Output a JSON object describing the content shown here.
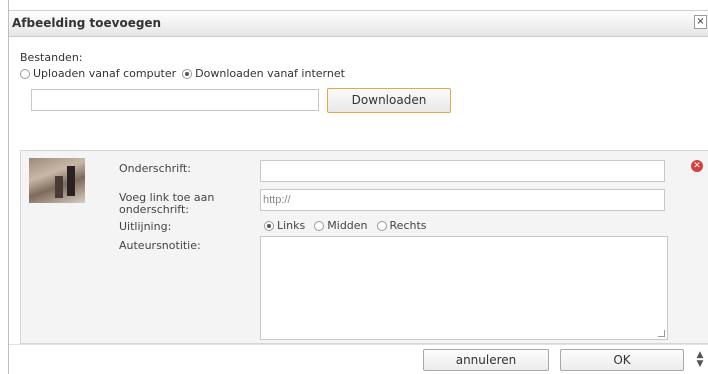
{
  "dialog": {
    "title": "Afbeelding toevoegen",
    "close_glyph": "×"
  },
  "source": {
    "label": "Bestanden:",
    "options": [
      {
        "label": "Uploaden vanaf computer",
        "selected": false
      },
      {
        "label": "Downloaden vanaf internet",
        "selected": true
      }
    ],
    "url_value": "",
    "download_button": "Downloaden"
  },
  "image": {
    "caption_label": "Onderschrift:",
    "caption_value": "",
    "link_label_line1": "Voeg link toe aan",
    "link_label_line2": "onderschrift:",
    "link_placeholder": "http://",
    "align_label": "Uitlijning:",
    "align_options": [
      {
        "label": "Links",
        "selected": true
      },
      {
        "label": "Midden",
        "selected": false
      },
      {
        "label": "Rechts",
        "selected": false
      }
    ],
    "author_label": "Auteursnotitie:",
    "author_value": "",
    "remove_icon": "remove-image-icon"
  },
  "footer": {
    "cancel": "annuleren",
    "ok": "OK"
  },
  "colors": {
    "accent_border": "#e2a84a",
    "remove": "#d24040"
  }
}
